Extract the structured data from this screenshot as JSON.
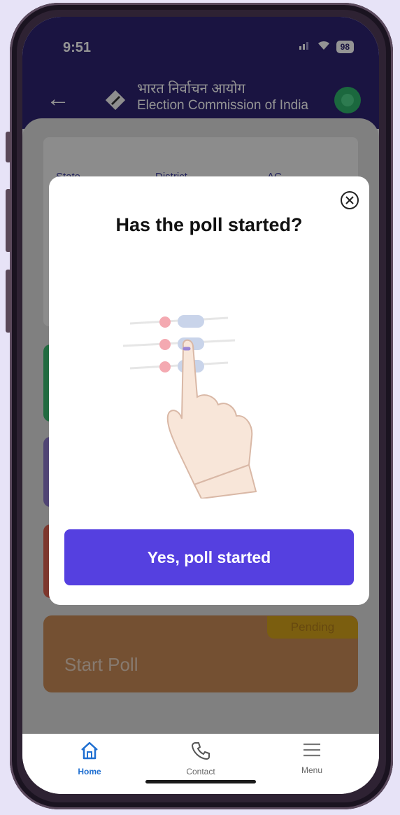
{
  "status_bar": {
    "time": "9:51",
    "battery": "98"
  },
  "header": {
    "title_hindi": "भारत निर्वाचन आयोग",
    "title_english": "Election Commission of India"
  },
  "background": {
    "info_labels": [
      "State",
      "District",
      "AC"
    ],
    "start_poll_label": "Start Poll",
    "pending_badge": "Pending"
  },
  "modal": {
    "title": "Has the poll started?",
    "primary_button": "Yes, poll started"
  },
  "bottom_nav": {
    "items": [
      {
        "label": "Home",
        "icon": "home-icon"
      },
      {
        "label": "Contact",
        "icon": "phone-icon"
      },
      {
        "label": "Menu",
        "icon": "menu-icon"
      }
    ]
  },
  "colors": {
    "app_bar": "#2d2470",
    "primary_button": "#5540e0",
    "nav_active": "#1f6fd1",
    "start_poll_card": "#c98a57",
    "pending_badge": "#d4a21b"
  }
}
